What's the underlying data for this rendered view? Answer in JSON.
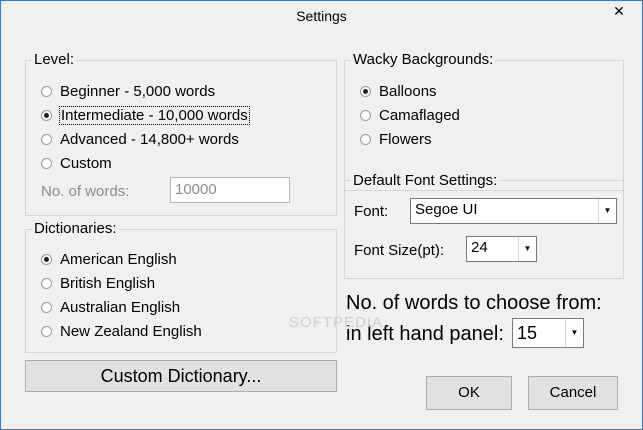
{
  "window": {
    "title": "Settings",
    "close_glyph": "✕"
  },
  "level": {
    "label": "Level:",
    "options": [
      "Beginner - 5,000 words",
      "Intermediate - 10,000 words",
      "Advanced - 14,800+ words",
      "Custom"
    ],
    "selected": "Intermediate - 10,000 words",
    "words_label": "No. of words:",
    "words_value": "10000"
  },
  "dictionaries": {
    "label": "Dictionaries:",
    "options": [
      "American English",
      "British English",
      "Australian English",
      "New Zealand English"
    ],
    "selected": "American English",
    "custom_button": "Custom Dictionary..."
  },
  "backgrounds": {
    "label": "Wacky Backgrounds:",
    "options": [
      "Balloons",
      "Camaflaged",
      "Flowers"
    ],
    "selected": "Balloons"
  },
  "font": {
    "label": "Default Font Settings:",
    "font_label": "Font:",
    "font_value": "Segoe UI",
    "size_label": "Font Size(pt):",
    "size_value": "24"
  },
  "choose": {
    "line1": "No. of words to choose from:",
    "line2": "in left hand panel:",
    "value": "15"
  },
  "buttons": {
    "ok": "OK",
    "cancel": "Cancel"
  },
  "watermark": "SOFTPEDIA"
}
